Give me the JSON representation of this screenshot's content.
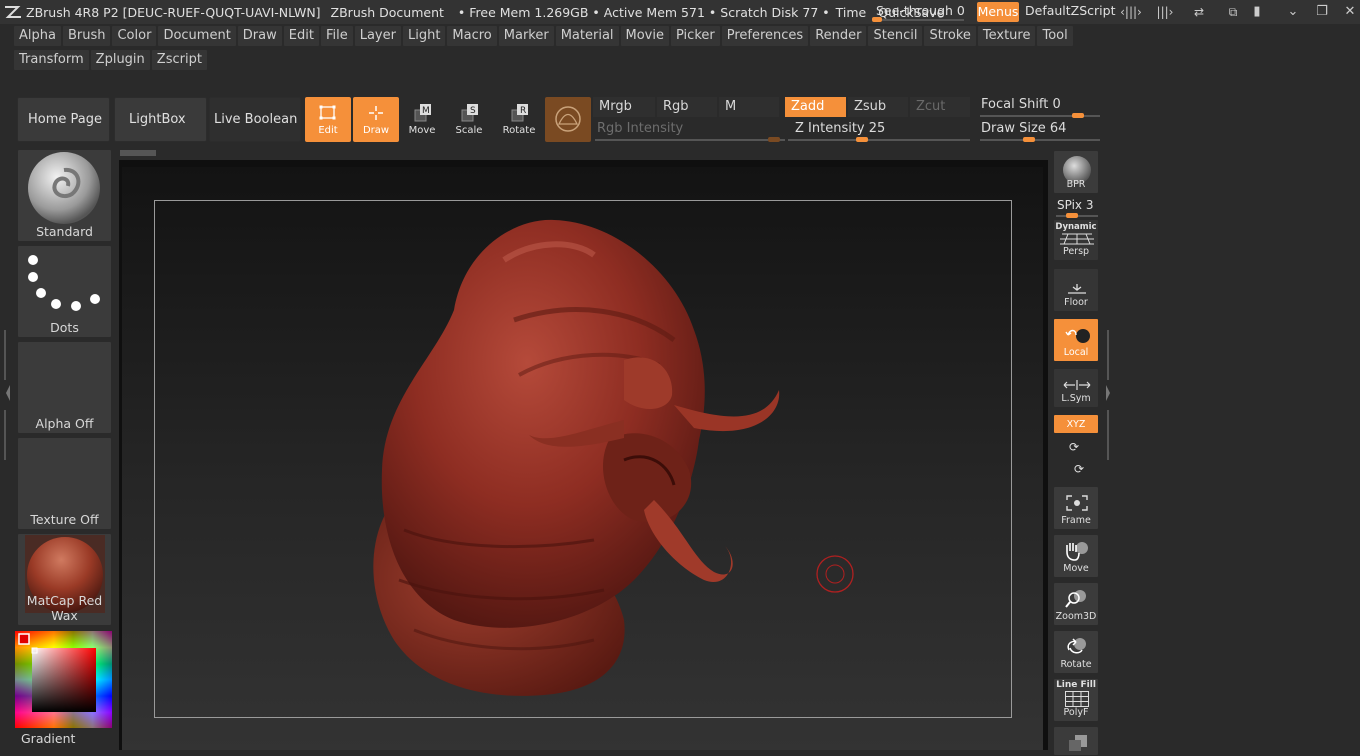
{
  "titlebar": {
    "app": "ZBrush 4R8 P2 [DEUC-RUEF-QUQT-UAVI-NLWN]",
    "document": "ZBrush Document",
    "free_mem": "• Free Mem 1.269GB •",
    "active_mem": "Active Mem 571 •",
    "scratch": "Scratch Disk 77 •",
    "time": "Time",
    "quicksave": "QuickSave",
    "see_through": "See-through  0",
    "menus": "Menus",
    "default_script": "DefaultZScript"
  },
  "menu_row1": [
    "Alpha",
    "Brush",
    "Color",
    "Document",
    "Draw",
    "Edit",
    "File",
    "Layer",
    "Light",
    "Macro",
    "Marker",
    "Material",
    "Movie",
    "Picker",
    "Preferences",
    "Render",
    "Stencil",
    "Stroke",
    "Texture",
    "Tool"
  ],
  "menu_row2": [
    "Transform",
    "Zplugin",
    "Zscript"
  ],
  "toolbar": {
    "home_page": "Home Page",
    "lightbox": "LightBox",
    "live_boolean": "Live Boolean",
    "edit": "Edit",
    "draw": "Draw",
    "move": "Move",
    "scale": "Scale",
    "rotate": "Rotate",
    "mrgb": "Mrgb",
    "rgb": "Rgb",
    "m": "M",
    "rgb_intensity": "Rgb Intensity",
    "zadd": "Zadd",
    "zsub": "Zsub",
    "zcut": "Zcut",
    "z_intensity": "Z Intensity 25",
    "focal_shift": "Focal Shift 0",
    "draw_size": "Draw Size 64",
    "z_intensity_level": 0.25,
    "focal_shift_level": 0.5,
    "draw_size_level": 0.5
  },
  "left_shelf": {
    "brush": "Standard",
    "stroke": "Dots",
    "alpha": "Alpha Off",
    "texture": "Texture Off",
    "material": "MatCap Red Wax",
    "gradient": "Gradient"
  },
  "right_shelf": {
    "bpr": "BPR",
    "spix": "SPix 3",
    "dynamic": "Dynamic",
    "persp": "Persp",
    "floor": "Floor",
    "local": "Local",
    "lsym": "L.Sym",
    "xyz": "XYZ",
    "frame": "Frame",
    "move": "Move",
    "zoom3d": "Zoom3D",
    "rotate": "Rotate",
    "line_fill": "Line Fill",
    "polyf": "PolyF"
  },
  "colors": {
    "accent": "#f5903a",
    "model": "#8e2d22"
  }
}
